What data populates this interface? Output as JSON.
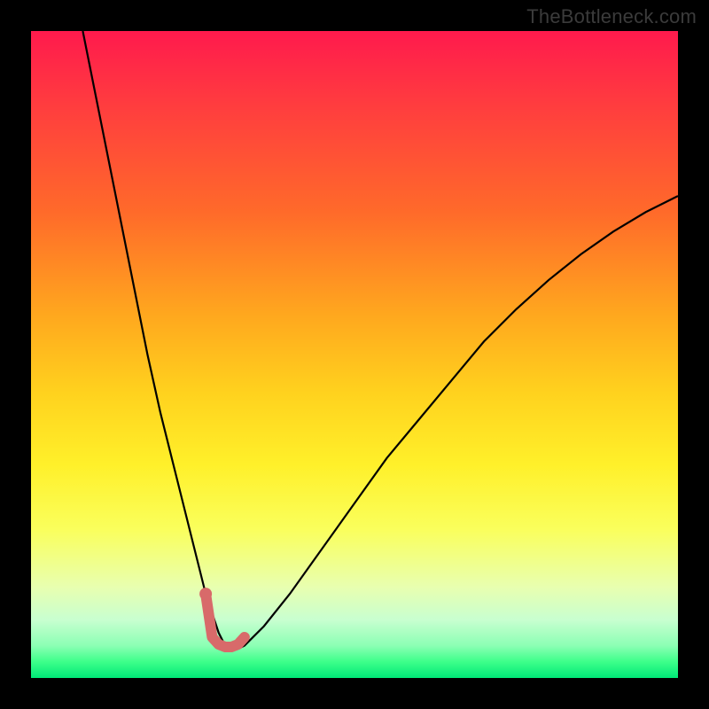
{
  "watermark": "TheBottleneck.com",
  "chart_data": {
    "type": "line",
    "title": "",
    "xlabel": "",
    "ylabel": "",
    "xlim": [
      0,
      100
    ],
    "ylim": [
      0,
      100
    ],
    "series": [
      {
        "name": "bottleneck-curve",
        "x": [
          8,
          10,
          12,
          14,
          16,
          18,
          20,
          22,
          24,
          26,
          27,
          28,
          29,
          30,
          31,
          32,
          33,
          34,
          36,
          40,
          45,
          50,
          55,
          60,
          65,
          70,
          75,
          80,
          85,
          90,
          95,
          100
        ],
        "values": [
          100,
          90,
          80,
          70,
          60,
          50,
          41,
          33,
          25,
          17,
          13,
          10,
          7,
          5,
          4.5,
          4.5,
          5,
          6,
          8,
          13,
          20,
          27,
          34,
          40,
          46,
          52,
          57,
          61.5,
          65.5,
          69,
          72,
          74.5
        ],
        "color": "#000000",
        "stroke_width": 2.2
      },
      {
        "name": "bottom-marker",
        "x": [
          27,
          28,
          29,
          30,
          31,
          32,
          33
        ],
        "values": [
          13,
          6.3,
          5.2,
          4.8,
          4.8,
          5.2,
          6.3
        ],
        "color": "#d86a6a",
        "stroke_width": 12
      }
    ],
    "marker_dot": {
      "x": 27,
      "y": 13,
      "r": 7,
      "color": "#d86a6a"
    }
  }
}
